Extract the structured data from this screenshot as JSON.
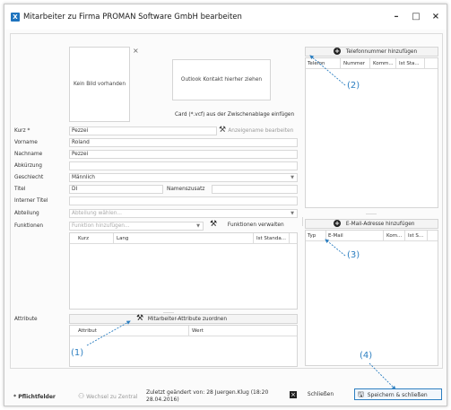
{
  "window": {
    "title": "Mitarbeiter zu Firma PROMAN Software GmbH bearbeiten",
    "app_icon_letter": "X",
    "minimize": "–",
    "maximize": "□",
    "close": "×"
  },
  "photo": {
    "no_image": "Kein Bild vorhanden",
    "remove": "×",
    "outlook_drop": "Outlook Kontakt hierher ziehen",
    "vcard": "Card (*.vcf) aus der Zwischenablage einfügen"
  },
  "form": {
    "kurz_label": "Kurz *",
    "kurz_value": "Pezzei",
    "display_name_button": "Anzeigename bearbeiten",
    "vorname_label": "Vorname",
    "vorname_value": "Roland",
    "nachname_label": "Nachname",
    "nachname_value": "Pezzei",
    "abkuerzung_label": "Abkürzung",
    "geschlecht_label": "Geschlecht",
    "geschlecht_value": "Männlich",
    "titel_label": "Titel",
    "titel_value": "DI",
    "namenszusatz_label": "Namenszusatz",
    "interner_titel_label": "Interner Titel",
    "abteilung_label": "Abteilung",
    "abteilung_placeholder": "Abteilung wählen...",
    "funktionen_label": "Funktionen",
    "funktionen_placeholder": "Funktion hinzufügen...",
    "funktionen_manage": "Funktionen verwalten",
    "funktionen_columns": [
      "Kurz",
      "Lang",
      "Ist Standa..."
    ],
    "attribute_label": "Attribute",
    "attribute_assign": "Mitarbeiter-Attribute zuordnen",
    "attribute_columns": [
      "Attribut",
      "Wert"
    ]
  },
  "phone": {
    "add_button": "Telefonnummer hinzufügen",
    "columns": [
      "Telefon",
      "Nummer",
      "Komm...",
      "Ist Sta..."
    ]
  },
  "email": {
    "add_button": "E-Mail-Adresse hinzufügen",
    "columns": [
      "Typ",
      "E-Mail",
      "Kom...",
      "Ist S..."
    ]
  },
  "annotations": [
    "(1)",
    "(2)",
    "(3)",
    "(4)"
  ],
  "footer": {
    "required": "* Pflichtfelder",
    "switch_central": "Wechsel zu Zentral",
    "last_changed_line1": "Zuletzt geändert von: 28 Juergen.Klug (18:20",
    "last_changed_line2": "28.04.2016)",
    "close_button": "Schließen",
    "save_close_button": "Speichern & schließen"
  },
  "colors": {
    "accent": "#2d7fc1",
    "app_icon": "#1e73be",
    "border": "#d5d5d5"
  }
}
